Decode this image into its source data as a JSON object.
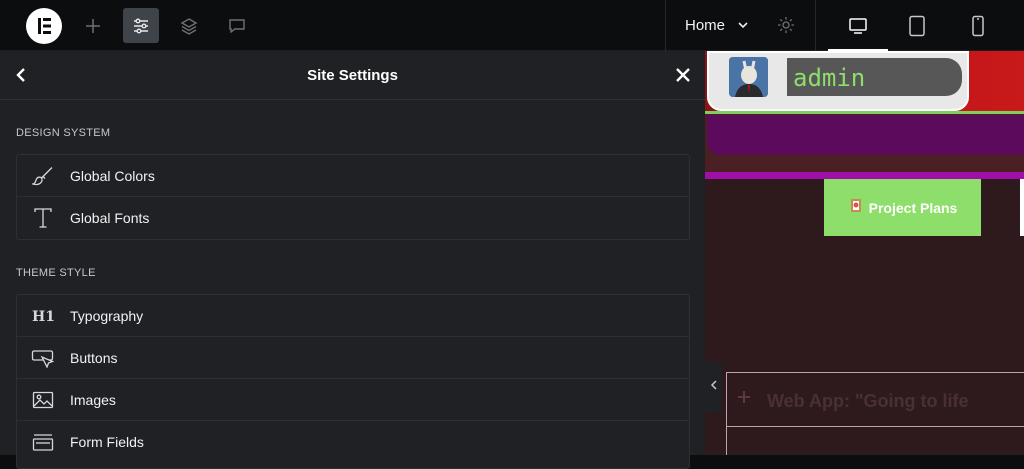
{
  "topbar": {
    "home_label": "Home"
  },
  "panel": {
    "title": "Site Settings",
    "sections": [
      {
        "title": "DESIGN SYSTEM",
        "items": [
          {
            "label": "Global Colors",
            "icon": "brush-icon"
          },
          {
            "label": "Global Fonts",
            "icon": "font-t-icon"
          }
        ]
      },
      {
        "title": "THEME STYLE",
        "items": [
          {
            "label": "Typography",
            "icon": "h1-icon"
          },
          {
            "label": "Buttons",
            "icon": "button-cursor-icon"
          },
          {
            "label": "Images",
            "icon": "image-icon"
          },
          {
            "label": "Form Fields",
            "icon": "form-fields-icon"
          }
        ]
      }
    ]
  },
  "preview": {
    "username": "admin",
    "project_button": "Project Plans",
    "list_item_text": "Web App: \"Going to life"
  },
  "colors": {
    "accent_green": "#8ede6b",
    "purple": "#5b0a5c",
    "magenta": "#a010a8",
    "red": "#c4141a"
  }
}
